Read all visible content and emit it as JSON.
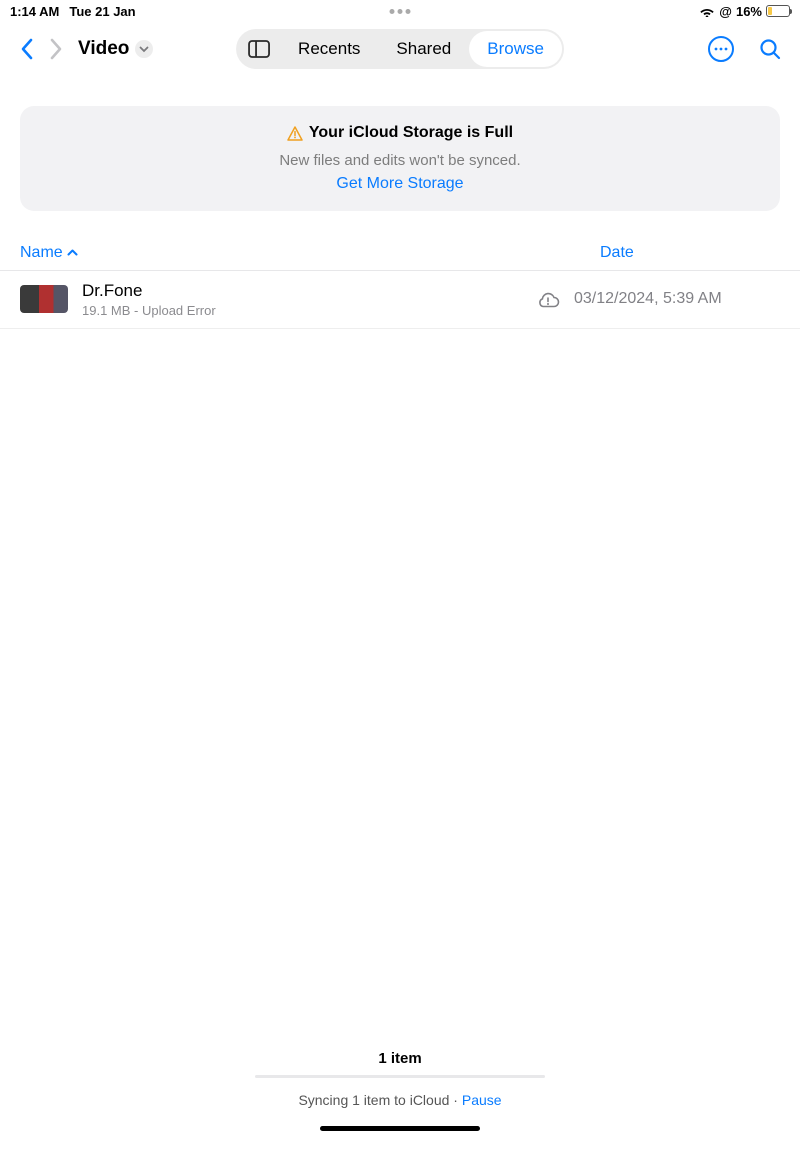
{
  "status": {
    "time": "1:14 AM",
    "date": "Tue 21 Jan",
    "battery_pct": "16%"
  },
  "nav": {
    "title": "Video",
    "tabs": {
      "recents": "Recents",
      "shared": "Shared",
      "browse": "Browse"
    }
  },
  "notice": {
    "title": "Your iCloud Storage is Full",
    "sub": "New files and edits won't be synced.",
    "link": "Get More Storage"
  },
  "columns": {
    "name": "Name",
    "date": "Date"
  },
  "row": {
    "name": "Dr.Fone",
    "sub": "19.1 MB - Upload Error",
    "date": "03/12/2024, 5:39 AM"
  },
  "footer": {
    "count": "1 item",
    "sync": "Syncing 1 item to iCloud",
    "sep": " · ",
    "pause": "Pause"
  }
}
